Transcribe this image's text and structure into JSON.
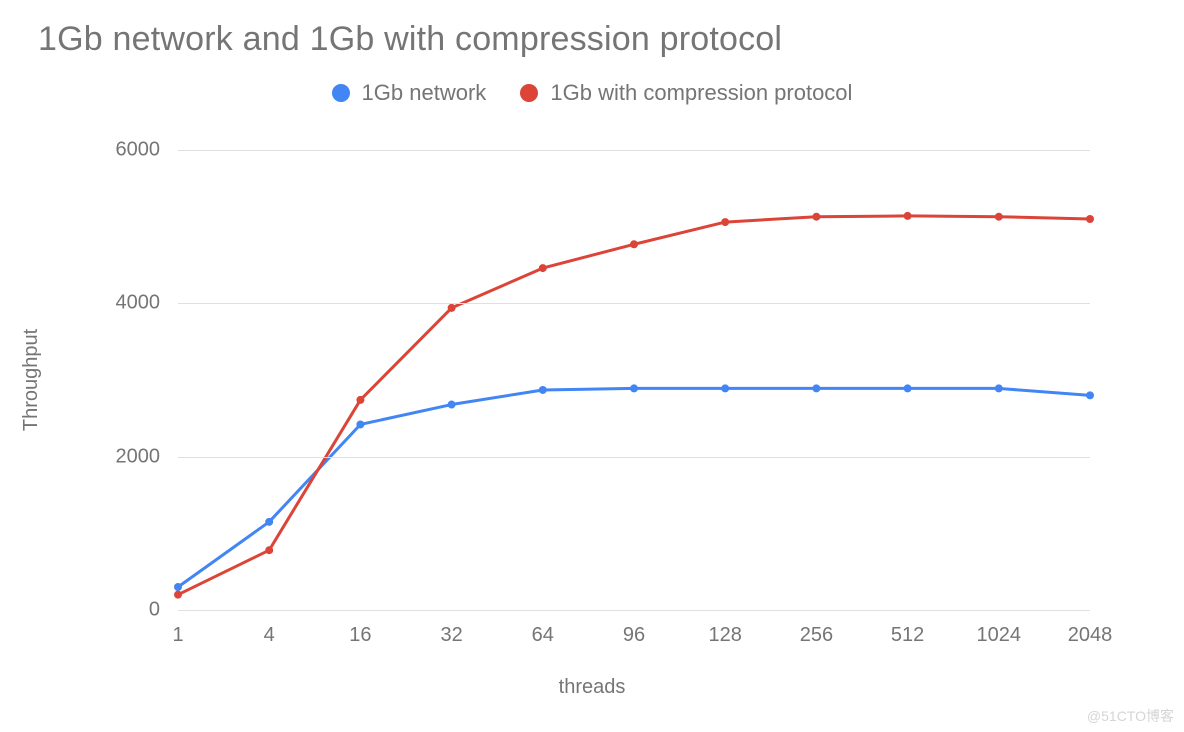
{
  "chart_data": {
    "type": "line",
    "title": "1Gb network and 1Gb with compression protocol",
    "xlabel": "threads",
    "ylabel": "Throughput",
    "ylim": [
      0,
      6000
    ],
    "y_ticks": [
      0,
      2000,
      4000,
      6000
    ],
    "categories": [
      "1",
      "4",
      "16",
      "32",
      "64",
      "96",
      "128",
      "256",
      "512",
      "1024",
      "2048"
    ],
    "series": [
      {
        "name": "1Gb network",
        "color": "#4285f4",
        "values": [
          300,
          1150,
          2420,
          2680,
          2870,
          2890,
          2890,
          2890,
          2890,
          2890,
          2800
        ]
      },
      {
        "name": "1Gb with compression protocol",
        "color": "#db4437",
        "values": [
          200,
          780,
          2740,
          3940,
          4460,
          4770,
          5060,
          5130,
          5140,
          5130,
          5100
        ]
      }
    ]
  },
  "watermark": "@51CTO博客"
}
